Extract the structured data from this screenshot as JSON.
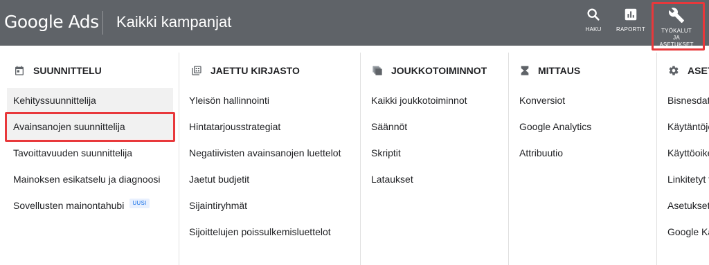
{
  "header": {
    "logo_google": "Google",
    "logo_ads": "Ads",
    "page_title": "Kaikki kampanjat",
    "tools": [
      {
        "label": "HAKU",
        "icon": "search-icon"
      },
      {
        "label": "RAPORTIT",
        "icon": "reports-icon"
      },
      {
        "label_line1": "TYÖKALUT",
        "label_line2": "JA",
        "label_line3": "ASETUKSET",
        "icon": "wrench-icon"
      }
    ]
  },
  "menu": {
    "columns": [
      {
        "heading": "SUUNNITTELU",
        "icon": "calendar-icon",
        "items": [
          {
            "label": "Kehityssuunnittelija"
          },
          {
            "label": "Avainsanojen suunnittelija"
          },
          {
            "label": "Tavoittavuuden suunnittelija"
          },
          {
            "label": "Mainoksen esikatselu ja diagnoosi"
          },
          {
            "label": "Sovellusten mainontahubi",
            "badge": "UUSI"
          }
        ]
      },
      {
        "heading": "JAETTU KIRJASTO",
        "icon": "library-icon",
        "items": [
          {
            "label": "Yleisön hallinnointi"
          },
          {
            "label": "Hintatarjousstrategiat"
          },
          {
            "label": "Negatiivisten avainsanojen luettelot"
          },
          {
            "label": "Jaetut budjetit"
          },
          {
            "label": "Sijaintiryhmät"
          },
          {
            "label": "Sijoittelujen poissulkemisluettelot"
          }
        ]
      },
      {
        "heading": "JOUKKOTOIMINNOT",
        "icon": "bulk-actions-icon",
        "items": [
          {
            "label": "Kaikki joukkotoiminnot"
          },
          {
            "label": "Säännöt"
          },
          {
            "label": "Skriptit"
          },
          {
            "label": "Lataukset"
          }
        ]
      },
      {
        "heading": "MITTAUS",
        "icon": "hourglass-icon",
        "items": [
          {
            "label": "Konversiot"
          },
          {
            "label": "Google Analytics"
          },
          {
            "label": "Attribuutio"
          }
        ]
      },
      {
        "heading": "ASETUKSET",
        "icon": "settings-icon",
        "items": [
          {
            "label": "Bisnesdata"
          },
          {
            "label": "Käytäntöjen hallinta"
          },
          {
            "label": "Käyttöoikeudet ja turvallisuus"
          },
          {
            "label": "Linkitetyt tilit"
          },
          {
            "label": "Asetukset"
          },
          {
            "label": "Google Kauppias"
          }
        ]
      }
    ]
  },
  "colors": {
    "header_bg": "#5f6368",
    "highlight": "#e8383b",
    "active_item_bg": "#f1f1f1",
    "badge_text": "#1a73e8"
  }
}
